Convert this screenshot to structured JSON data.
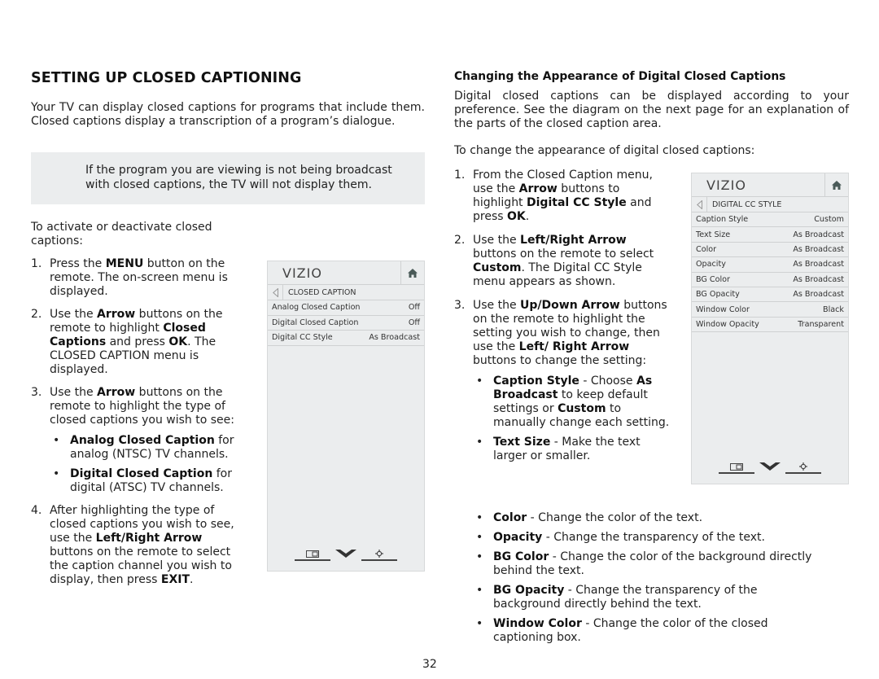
{
  "left": {
    "title": "SETTING UP CLOSED CAPTIONING",
    "intro": "Your TV can display closed captions for programs that include them. Closed captions display a transcription of a program’s dialogue.",
    "note": "If the program you are viewing is not being broadcast with closed captions, the TV will not display them.",
    "lead": "To activate or deactivate closed captions:",
    "steps": [
      {
        "num": "1.",
        "t1": "Press the ",
        "b1": "MENU",
        "t2": " button on the remote. The on-screen menu is displayed."
      },
      {
        "num": "2.",
        "t1": "Use the ",
        "b1": "Arrow",
        "t2": " buttons on the remote to highlight ",
        "b2": "Closed Captions",
        "t3": " and press ",
        "b3": "OK",
        "t4": ". The CLOSED CAPTION menu is displayed."
      },
      {
        "num": "3.",
        "t1": "Use the ",
        "b1": "Arrow",
        "t2": " buttons on the remote to highlight the type of closed captions you wish to see:",
        "bullets": [
          {
            "b": "Analog Closed Caption",
            "t": " for analog (NTSC) TV channels."
          },
          {
            "b": "Digital Closed Caption",
            "t": " for digital (ATSC) TV channels."
          }
        ]
      },
      {
        "num": "4.",
        "t1": "After highlighting the type of closed captions you wish to see, use the ",
        "b1": "Left/Right Arrow",
        "t2": " buttons on the remote to select the caption channel you wish to display, then press ",
        "b2": "EXIT",
        "t3": "."
      }
    ]
  },
  "right": {
    "subhead": "Changing the Appearance of Digital Closed Captions",
    "intro": "Digital closed captions can be displayed according to your preference. See the diagram on the next page for an explanation of the parts of the closed caption area.",
    "lead": "To change the appearance of digital closed captions:",
    "steps": [
      {
        "num": "1.",
        "t1": "From the Closed Caption menu, use the ",
        "b1": "Arrow",
        "t2": " buttons to highlight ",
        "b2": "Digital CC Style",
        "t3": " and press ",
        "b3": "OK",
        "t4": "."
      },
      {
        "num": "2.",
        "t1": "Use the ",
        "b1": "Left/Right Arrow",
        "t2": " buttons on the remote to select ",
        "b2": "Custom",
        "t3": ". The Digital CC Style menu appears as shown."
      },
      {
        "num": "3.",
        "t1": "Use the ",
        "b1": "Up/Down Arrow",
        "t2": " buttons on the remote to highlight the setting you wish to change, then use the ",
        "b2": "Left/ Right Arrow",
        "t3": " buttons to change the setting:"
      }
    ],
    "bullets_narrow": [
      {
        "b": "Caption Style",
        "t1": " - Choose ",
        "b2": "As Broadcast",
        "t2": " to keep default settings or ",
        "b3": "Custom",
        "t3": " to manually change each setting."
      },
      {
        "b": "Text Size",
        "t1": " - Make the text larger or smaller."
      }
    ],
    "bullets_wide": [
      {
        "b": "Color",
        "t": " - Change the color of the text."
      },
      {
        "b": "Opacity",
        "t": " - Change the transparency of the text."
      },
      {
        "b": "BG Color",
        "t": " - Change the color of the background directly behind the text."
      },
      {
        "b": "BG Opacity",
        "t": " - Change the transparency of the background directly behind the text."
      },
      {
        "b": "Window Color",
        "t": " - Change the color of the closed captioning box."
      }
    ]
  },
  "menu_cc": {
    "logo": "VIZIO",
    "header": "CLOSED CAPTION",
    "rows": [
      {
        "label": "Analog Closed Caption",
        "value": "Off"
      },
      {
        "label": "Digital Closed Caption",
        "value": "Off"
      },
      {
        "label": "Digital CC Style",
        "value": "As Broadcast"
      }
    ]
  },
  "menu_style": {
    "logo": "VIZIO",
    "header": "DIGITAL CC STYLE",
    "rows": [
      {
        "label": "Caption Style",
        "value": "Custom"
      },
      {
        "label": "Text Size",
        "value": "As Broadcast"
      },
      {
        "label": "Color",
        "value": "As Broadcast"
      },
      {
        "label": "Opacity",
        "value": "As Broadcast"
      },
      {
        "label": "BG Color",
        "value": "As Broadcast"
      },
      {
        "label": "BG Opacity",
        "value": "As Broadcast"
      },
      {
        "label": "Window Color",
        "value": "Black"
      },
      {
        "label": "Window Opacity",
        "value": "Transparent"
      }
    ]
  },
  "icons": {
    "home": "home-icon",
    "back": "back-arrow-icon",
    "footer": [
      "input-icon",
      "wide-icon",
      "settings-icon"
    ]
  },
  "page_number": "32"
}
